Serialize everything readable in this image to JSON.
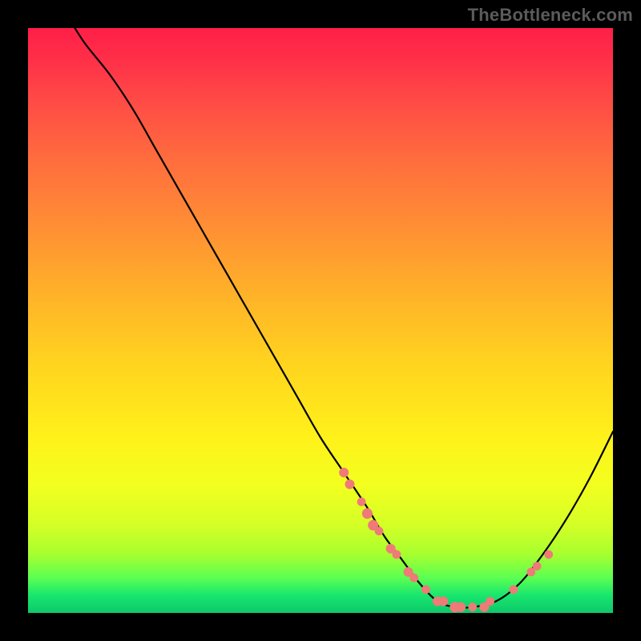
{
  "watermark": "TheBottleneck.com",
  "chart_data": {
    "type": "line",
    "title": "",
    "xlabel": "",
    "ylabel": "",
    "xlim": [
      0,
      100
    ],
    "ylim": [
      0,
      100
    ],
    "grid": false,
    "legend": false,
    "series": [
      {
        "name": "curve",
        "x": [
          8,
          10,
          14,
          18,
          22,
          26,
          30,
          34,
          38,
          42,
          46,
          50,
          54,
          58,
          61,
          64,
          67,
          70,
          73,
          76,
          80,
          84,
          88,
          92,
          96,
          100
        ],
        "y": [
          100,
          97,
          92,
          86,
          79,
          72,
          65,
          58,
          51,
          44,
          37,
          30,
          24,
          18,
          13,
          9,
          5,
          2,
          1,
          1,
          2,
          5,
          10,
          16,
          23,
          31
        ]
      }
    ],
    "markers": [
      {
        "x": 54,
        "y": 24,
        "r": 1.0
      },
      {
        "x": 55,
        "y": 22,
        "r": 1.0
      },
      {
        "x": 57,
        "y": 19,
        "r": 0.9
      },
      {
        "x": 58,
        "y": 17,
        "r": 1.1
      },
      {
        "x": 59,
        "y": 15,
        "r": 1.1
      },
      {
        "x": 60,
        "y": 14,
        "r": 0.9
      },
      {
        "x": 62,
        "y": 11,
        "r": 1.0
      },
      {
        "x": 63,
        "y": 10,
        "r": 0.9
      },
      {
        "x": 65,
        "y": 7,
        "r": 1.0
      },
      {
        "x": 66,
        "y": 6,
        "r": 0.9
      },
      {
        "x": 68,
        "y": 4,
        "r": 0.9
      },
      {
        "x": 70,
        "y": 2,
        "r": 1.0
      },
      {
        "x": 71,
        "y": 2,
        "r": 1.0
      },
      {
        "x": 73,
        "y": 1,
        "r": 1.1
      },
      {
        "x": 74,
        "y": 1,
        "r": 1.0
      },
      {
        "x": 76,
        "y": 1,
        "r": 0.9
      },
      {
        "x": 78,
        "y": 1,
        "r": 1.0
      },
      {
        "x": 79,
        "y": 2,
        "r": 0.9
      },
      {
        "x": 83,
        "y": 4,
        "r": 0.9
      },
      {
        "x": 86,
        "y": 7,
        "r": 0.9
      },
      {
        "x": 87,
        "y": 8,
        "r": 0.9
      },
      {
        "x": 89,
        "y": 10,
        "r": 0.9
      }
    ],
    "colors": {
      "curve": "#000000",
      "marker": "#ef7a78"
    }
  }
}
